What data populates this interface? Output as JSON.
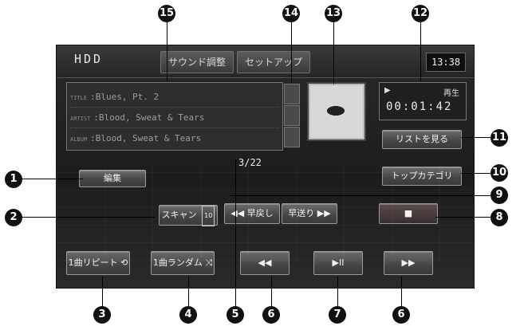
{
  "topbar": {
    "source_label": "HDD",
    "tab_sound": "サウンド調整",
    "tab_setup": "セットアップ",
    "clock": "13:38"
  },
  "track_info": {
    "title_key": "TITLE",
    "title_value": ":Blues, Pt. 2",
    "artist_key": "ARTIST",
    "artist_value": ":Blood, Sweat & Tears",
    "album_key": "ALBUM",
    "album_value": ":Blood, Sweat & Tears"
  },
  "side_buttons": [
    "",
    "",
    ""
  ],
  "status": {
    "play_icon": "▶",
    "state": "再生",
    "elapsed": "00:01:42"
  },
  "buttons": {
    "list_view": "リストを見る",
    "top_category": "トップカテゴリ",
    "edit": "編集",
    "scan": "スキャン",
    "scan_badge": "10",
    "repeat": "1曲リピート",
    "random": "1曲ランダム",
    "rewind": "◀◀ 早戻し",
    "fast_forward": "早送り ▶▶",
    "stop": "■",
    "prev": "◀◀",
    "play_pause": "▶II",
    "next": "▶▶"
  },
  "track_count": "3/22",
  "callouts": [
    "1",
    "2",
    "3",
    "4",
    "5",
    "6",
    "7",
    "8",
    "9",
    "10",
    "11",
    "12",
    "13",
    "14",
    "15",
    "6"
  ]
}
